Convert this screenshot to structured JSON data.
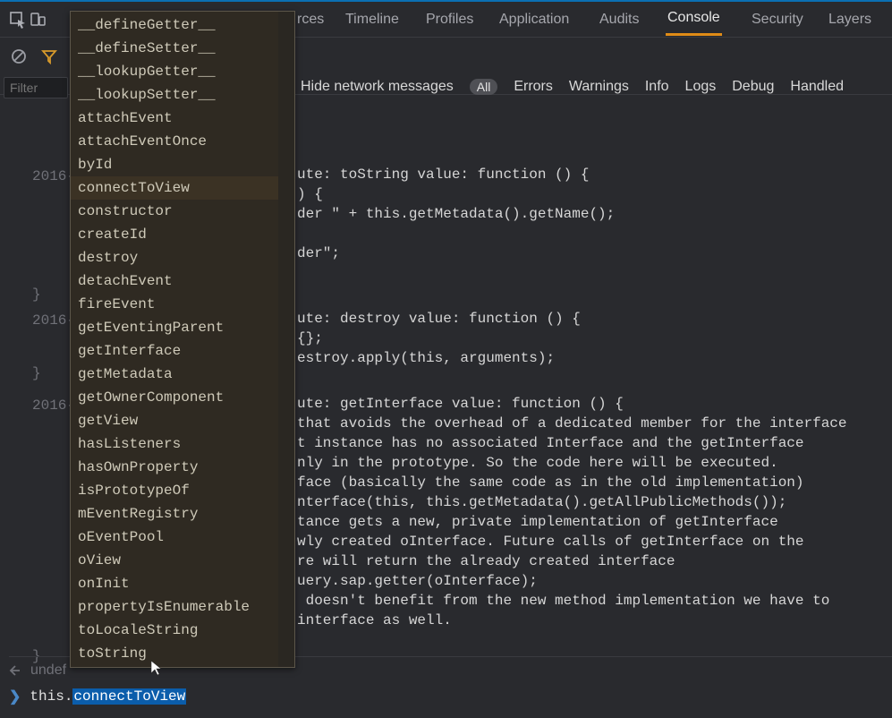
{
  "tabs": {
    "sources": "rces",
    "timeline": "Timeline",
    "profiles": "Profiles",
    "application": "Application",
    "audits": "Audits",
    "console": "Console",
    "security": "Security",
    "layers": "Layers"
  },
  "toolbar": {
    "filter_placeholder": "Filter",
    "hide_net": "Hide network messages",
    "all": "All",
    "errors": "Errors",
    "warnings": "Warnings",
    "info": "Info",
    "logs": "Logs",
    "debug": "Debug",
    "handled": "Handled"
  },
  "gutter": {
    "y1": "2016-",
    "y2": "2016-",
    "y3": "2016-"
  },
  "brace1": "}",
  "brace2": "}",
  "brace3": "}",
  "code1": "ute: toString value: function () {\n) {\nder \" + this.getMetadata().getName();\n\nder\";",
  "code2": "ute: destroy value: function () {\n{};\nestroy.apply(this, arguments);",
  "code3": "ute: getInterface value: function () {\nthat avoids the overhead of a dedicated member for the interface\nt instance has no associated Interface and the getInterface\nnly in the prototype. So the code here will be executed.\nface (basically the same code as in the old implementation)\nnterface(this, this.getMetadata().getAllPublicMethods());\ntance gets a new, private implementation of getInterface\nwly created oInterface. Future calls of getInterface on the\nre will return the already created interface\nuery.sap.getter(oInterface);\n doesn't benefit from the new method implementation we have to\ninterface as well.",
  "output": {
    "undefined": "undef"
  },
  "prompt": {
    "prefix": "this.",
    "selection": "connectToView"
  },
  "autocomplete": {
    "items": [
      "__defineGetter__",
      "__defineSetter__",
      "__lookupGetter__",
      "__lookupSetter__",
      "attachEvent",
      "attachEventOnce",
      "byId",
      "connectToView",
      "constructor",
      "createId",
      "destroy",
      "detachEvent",
      "fireEvent",
      "getEventingParent",
      "getInterface",
      "getMetadata",
      "getOwnerComponent",
      "getView",
      "hasListeners",
      "hasOwnProperty",
      "isPrototypeOf",
      "mEventRegistry",
      "oEventPool",
      "oView",
      "onInit",
      "propertyIsEnumerable",
      "toLocaleString",
      "toString"
    ],
    "selected_index": 7
  }
}
